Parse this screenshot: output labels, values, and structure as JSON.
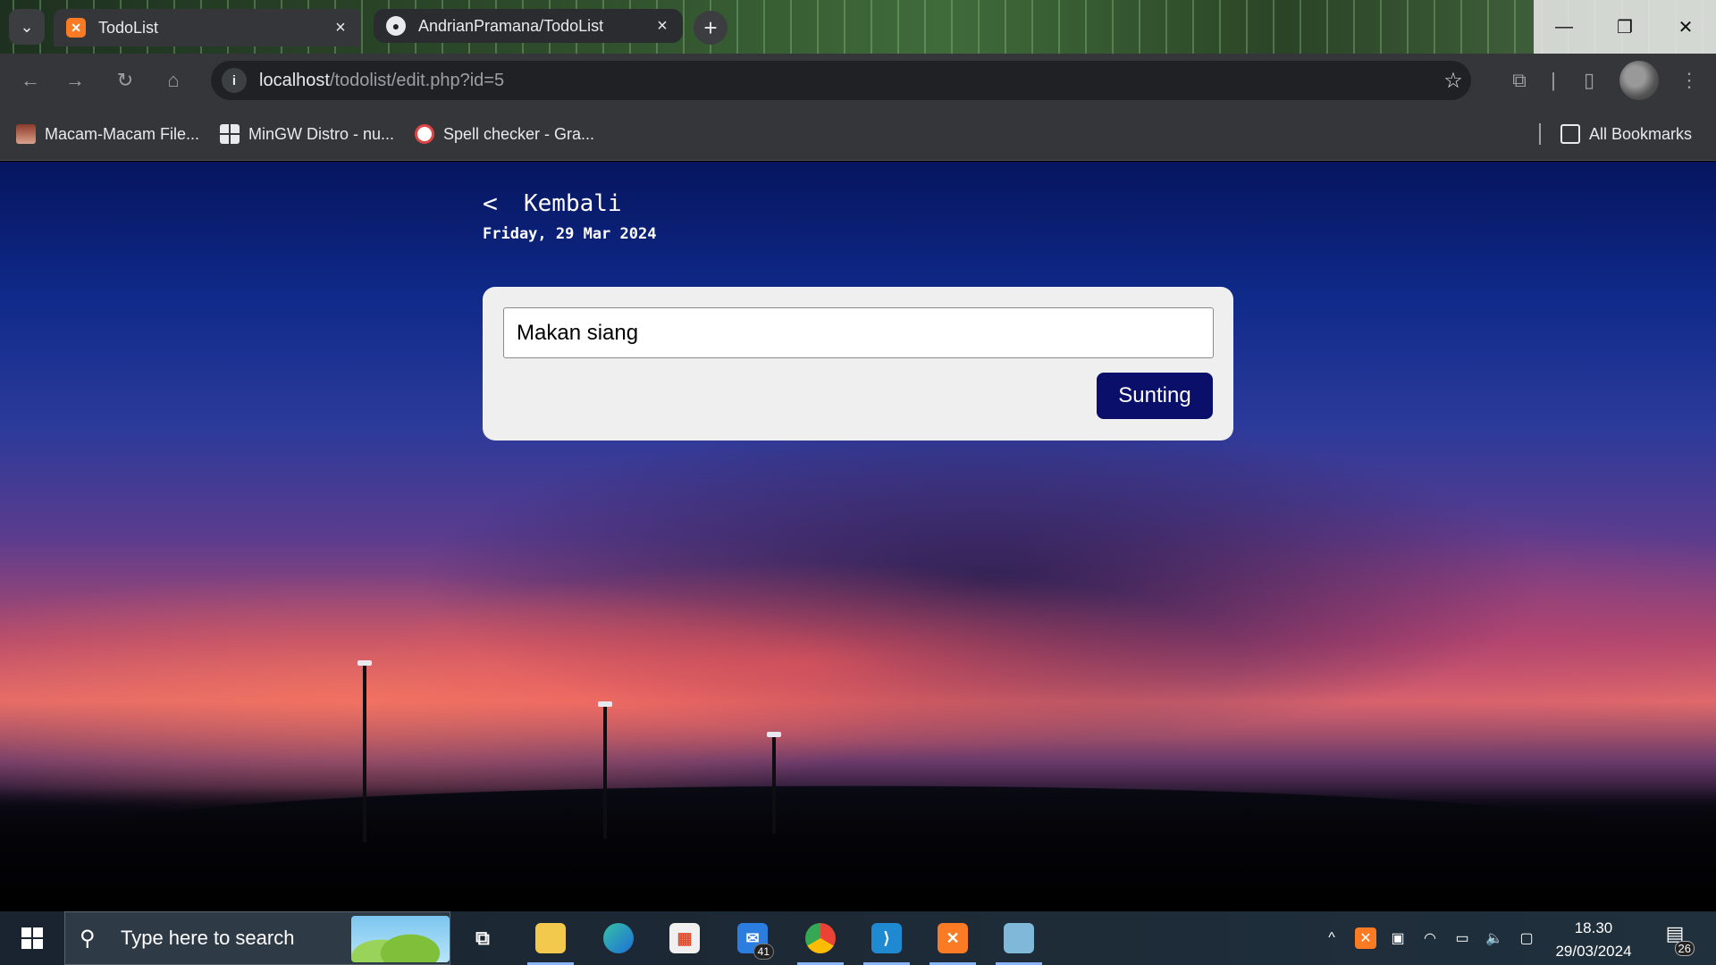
{
  "browser": {
    "tabs": [
      {
        "title": "TodoList",
        "favicon": "xampp-icon",
        "active": true
      },
      {
        "title": "AndrianPramana/TodoList",
        "favicon": "github-icon",
        "active": false
      }
    ],
    "url_host": "localhost",
    "url_path": "/todolist/edit.php?id=5",
    "bookmarks": [
      {
        "label": "Macam-Macam File..."
      },
      {
        "label": "MinGW Distro - nu..."
      },
      {
        "label": "Spell checker - Gra..."
      }
    ],
    "all_bookmarks_label": "All Bookmarks"
  },
  "page": {
    "back_label": "Kembali",
    "date": "Friday, 29 Mar 2024",
    "todo_value": "Makan siang",
    "save_label": "Sunting",
    "accent_color": "#0a0f6a"
  },
  "taskbar": {
    "search_placeholder": "Type here to search",
    "mail_badge": "41",
    "time": "18.30",
    "date": "29/03/2024",
    "notification_count": "26"
  }
}
